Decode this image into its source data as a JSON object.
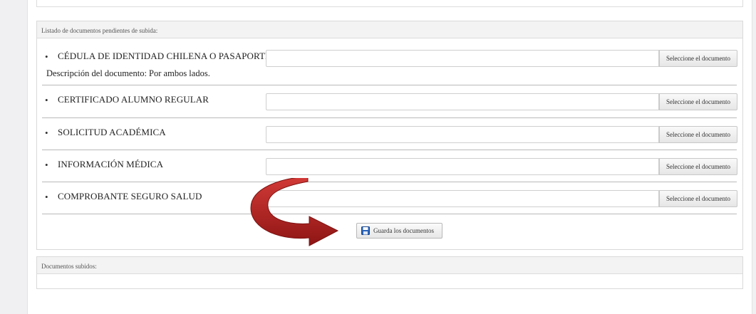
{
  "pending_panel": {
    "title": "Listado de documentos pendientes de subida:",
    "documents": [
      {
        "bullet": "•",
        "name": "CÉDULA DE IDENTIDAD CHILENA O PASAPORTE",
        "description": "Descripción del documento: Por ambos lados.",
        "button_label": "Seleccione el documento"
      },
      {
        "bullet": "•",
        "name": "CERTIFICADO ALUMNO REGULAR",
        "button_label": "Seleccione el documento"
      },
      {
        "bullet": "•",
        "name": "SOLICITUD ACADÉMICA",
        "button_label": "Seleccione el documento"
      },
      {
        "bullet": "•",
        "name": "INFORMACIÓN MÉDICA",
        "button_label": "Seleccione el documento"
      },
      {
        "bullet": "•",
        "name": "COMPROBANTE SEGURO SALUD",
        "button_label": "Seleccione el documento"
      }
    ],
    "save_label": "Guarda los documentos"
  },
  "uploaded_panel": {
    "title": "Documentos subidos:"
  },
  "colors": {
    "arrow": "#b3201f",
    "save_icon": "#2a63b8"
  }
}
